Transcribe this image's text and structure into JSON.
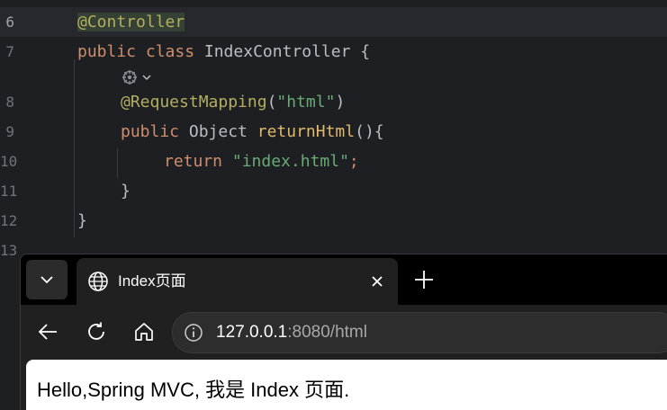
{
  "editor": {
    "lines": [
      {
        "num": "6"
      },
      {
        "num": "7"
      },
      {
        "num": ""
      },
      {
        "num": "8"
      },
      {
        "num": "9"
      },
      {
        "num": "10"
      },
      {
        "num": "11"
      },
      {
        "num": "12"
      },
      {
        "num": "13"
      }
    ],
    "tokens": {
      "l6_anno": "@Controller",
      "l7_kw": "public class",
      "l7_rest": " IndexController {",
      "l8_anno": "@RequestMapping",
      "l8_paren_open": "(",
      "l8_str": "\"html\"",
      "l8_paren_close": ")",
      "l9_kw": "public",
      "l9_type": " Object ",
      "l9_fn": "returnHtml",
      "l9_rest": "(){",
      "l10_kw": "return",
      "l10_str": " \"index.html\"",
      "l10_semi": ";",
      "l11_brace": "}",
      "l12_brace": "}"
    }
  },
  "browser": {
    "tab_title": "Index页面",
    "address_host": "127.0.0.1",
    "address_rest": ":8080/html",
    "page_text": "Hello,Spring MVC, 我是 Index 页面."
  },
  "icons": {
    "gutter": "spring-bean-icon",
    "tab": "globe-icon",
    "nav": [
      "back-arrow-icon",
      "refresh-icon",
      "home-icon"
    ],
    "address": "info-icon"
  }
}
